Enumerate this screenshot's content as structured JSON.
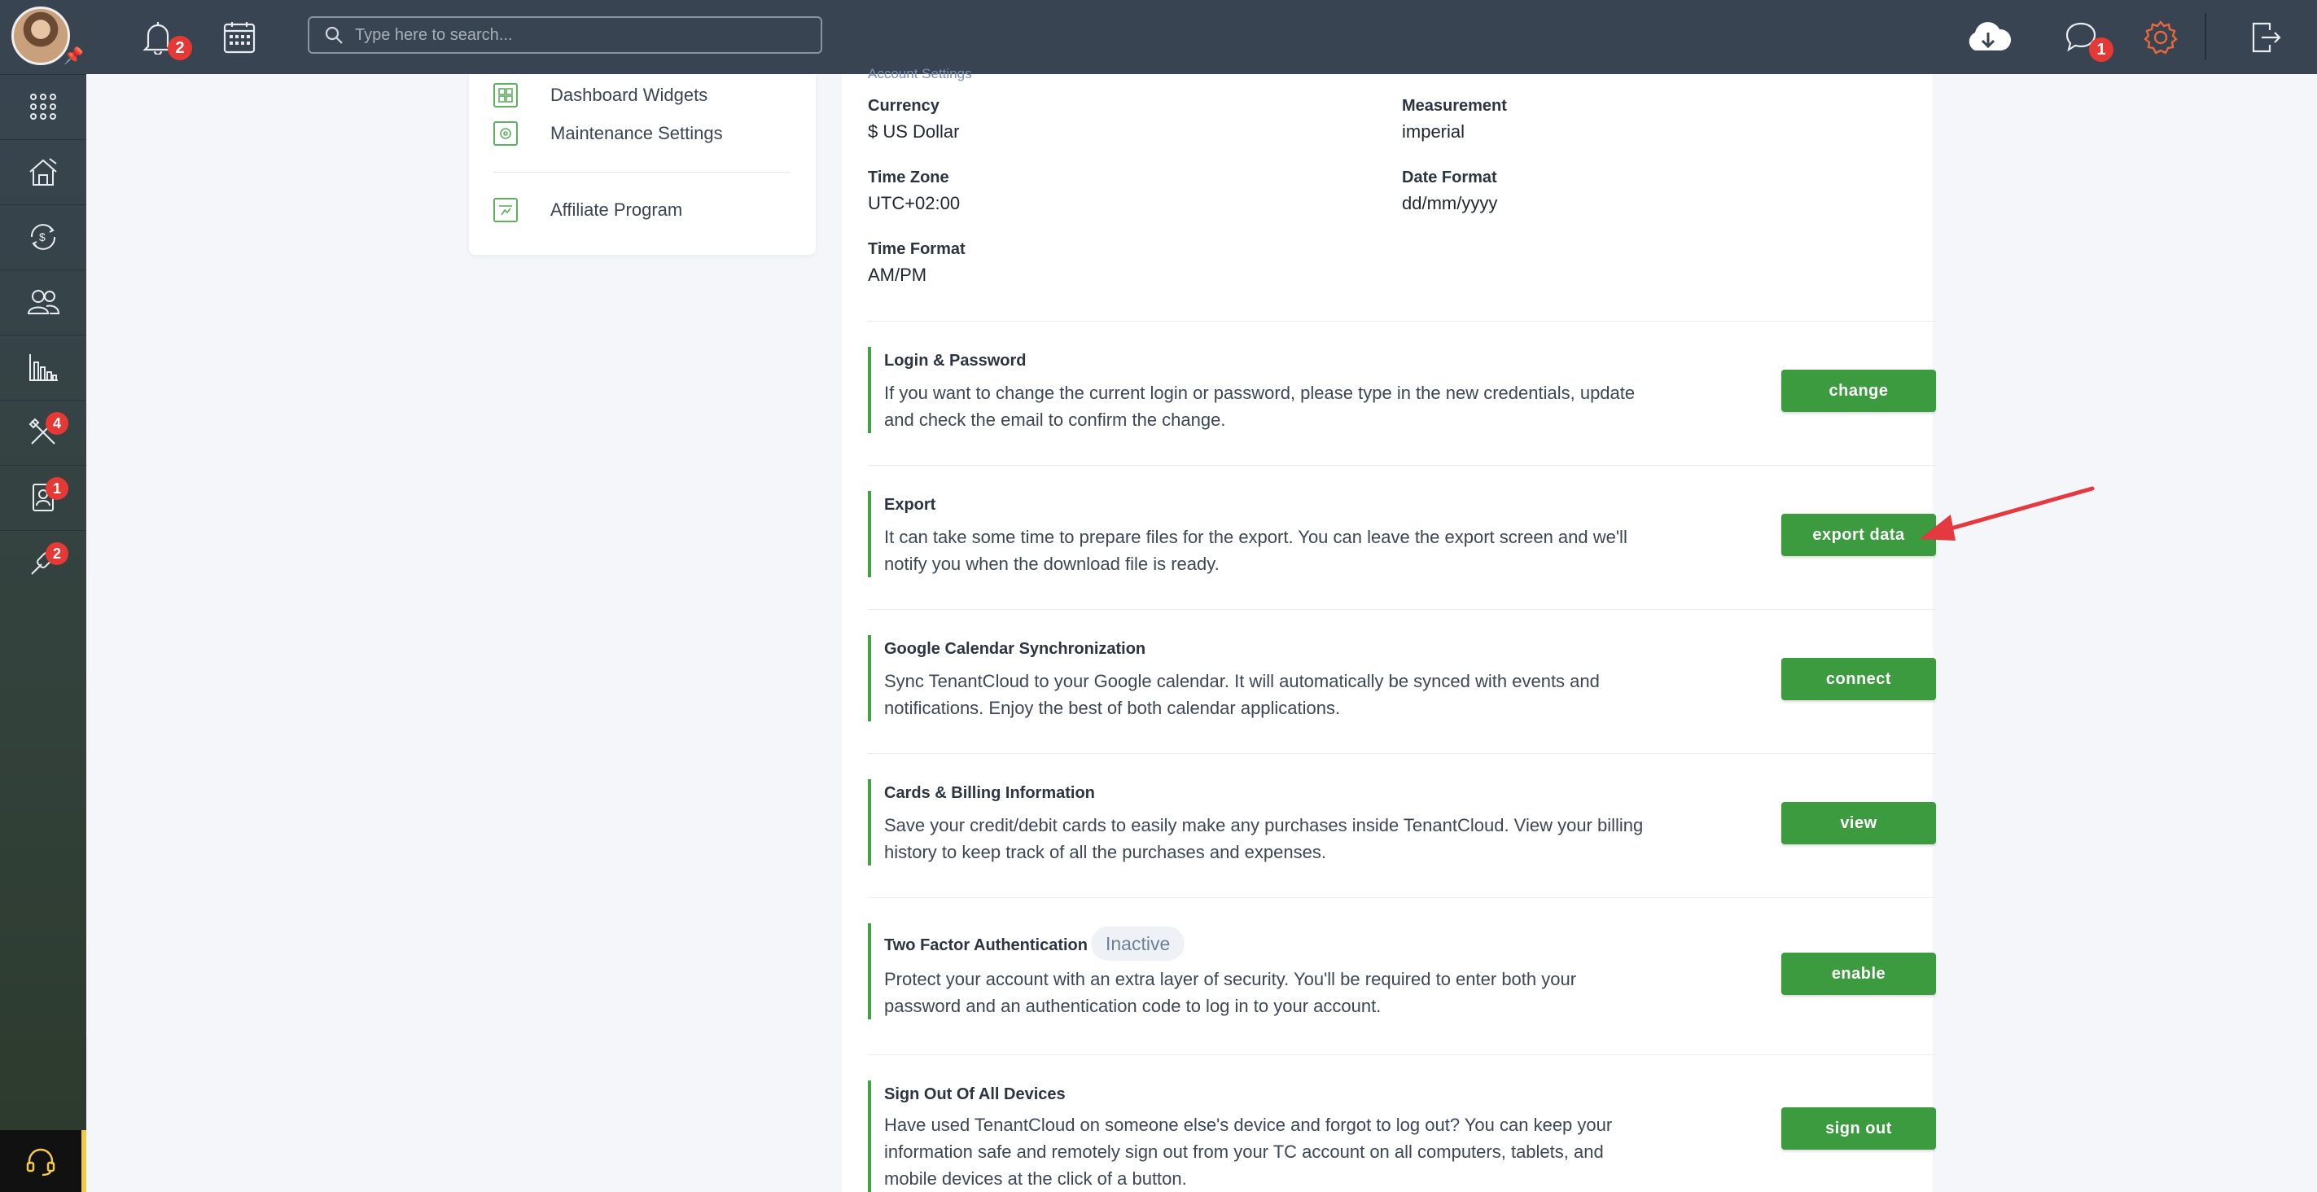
{
  "topbar": {
    "notifications_count": "2",
    "search_placeholder": "Type here to search...",
    "messages_count": "1"
  },
  "sidebar": {
    "items": [
      {
        "name": "apps",
        "badge": ""
      },
      {
        "name": "properties",
        "badge": ""
      },
      {
        "name": "transactions",
        "badge": ""
      },
      {
        "name": "contacts",
        "badge": ""
      },
      {
        "name": "reports",
        "badge": ""
      },
      {
        "name": "maintenance",
        "badge": "4"
      },
      {
        "name": "applications",
        "badge": "1"
      },
      {
        "name": "marketing",
        "badge": "2"
      }
    ]
  },
  "settings_nav": {
    "items": [
      {
        "label": "Dashboard Widgets"
      },
      {
        "label": "Maintenance Settings"
      },
      {
        "label": "Affiliate Program"
      }
    ]
  },
  "account": {
    "section_title": "Account Settings",
    "currency_label": "Currency",
    "currency_value": "$ US Dollar",
    "measurement_label": "Measurement",
    "measurement_value": "imperial",
    "timezone_label": "Time Zone",
    "timezone_value": "UTC+02:00",
    "dateformat_label": "Date Format",
    "dateformat_value": "dd/mm/yyyy",
    "timeformat_label": "Time Format",
    "timeformat_value": "AM/PM"
  },
  "settings": [
    {
      "title": "Login & Password",
      "desc": "If you want to change the current login or password, please type in the new credentials, update and check the email to confirm the change.",
      "button": "change"
    },
    {
      "title": "Export",
      "desc": "It can take some time to prepare files for the export. You can leave the export screen and we'll notify you when the download file is ready.",
      "button": "export data"
    },
    {
      "title": "Google Calendar Synchronization",
      "desc": "Sync TenantCloud to your Google calendar. It will automatically be synced with events and notifications. Enjoy the best of both calendar applications.",
      "button": "connect"
    },
    {
      "title": "Cards & Billing Information",
      "desc": "Save your credit/debit cards to easily make any purchases inside TenantCloud. View your billing history to keep track of all the purchases and expenses.",
      "button": "view"
    },
    {
      "title": "Two Factor Authentication",
      "status": "Inactive",
      "desc": "Protect your account with an extra layer of security. You'll be required to enter both your password and an authentication code to log in to your account.",
      "button": "enable"
    },
    {
      "title": "Sign Out Of All Devices",
      "desc": "Have used TenantCloud on someone else's device and forgot to log out? You can keep your information safe and remotely sign out from your TC account on all computers, tablets, and mobile devices at the click of a button.",
      "button": "sign out"
    }
  ],
  "colors": {
    "accent_green": "#3c9a3f",
    "topbar": "#394452",
    "badge_red": "#e53935",
    "arrow_red": "#e53940"
  }
}
